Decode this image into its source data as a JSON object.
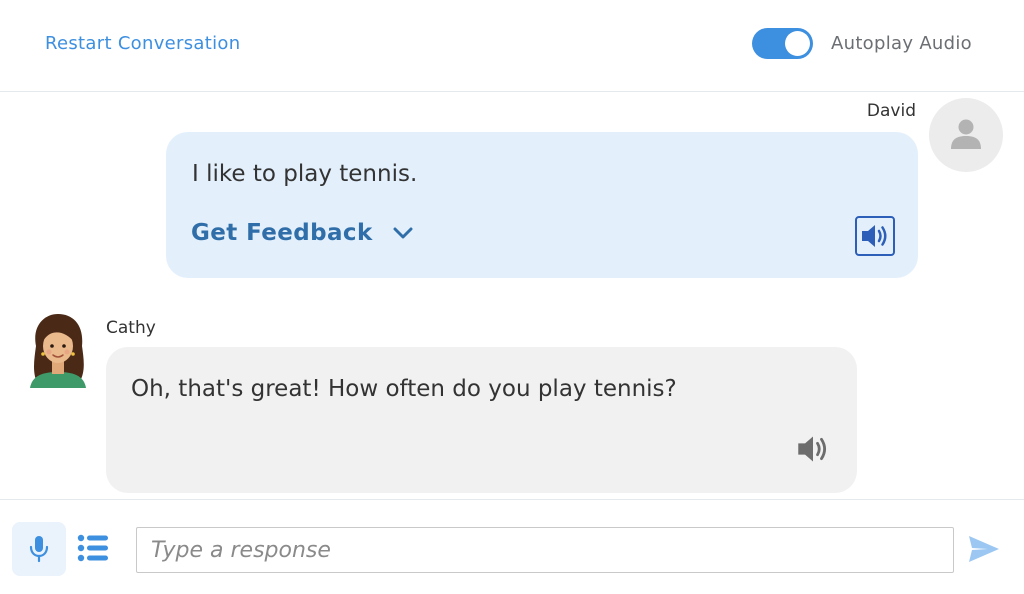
{
  "header": {
    "restart_label": "Restart Conversation",
    "autoplay_label": "Autoplay Audio",
    "autoplay_on": true
  },
  "conversation": {
    "messages": [
      {
        "sender": "David",
        "text": "I like to play tennis.",
        "feedback_label": "Get Feedback",
        "avatar_icon": "user-silhouette-icon",
        "audio_icon": "speaker-icon"
      },
      {
        "sender": "Cathy",
        "text": "Oh, that's great! How often do you play tennis?",
        "avatar_icon": "cathy-avatar",
        "audio_icon": "speaker-icon"
      }
    ]
  },
  "composer": {
    "placeholder": "Type a response",
    "mic_icon": "microphone-icon",
    "list_icon": "list-icon",
    "send_icon": "send-icon"
  },
  "colors": {
    "accent": "#3d8fe0",
    "user_bubble": "#e3f0fc",
    "bot_bubble": "#f1f1f1",
    "feedback_text": "#2f6ea8"
  }
}
